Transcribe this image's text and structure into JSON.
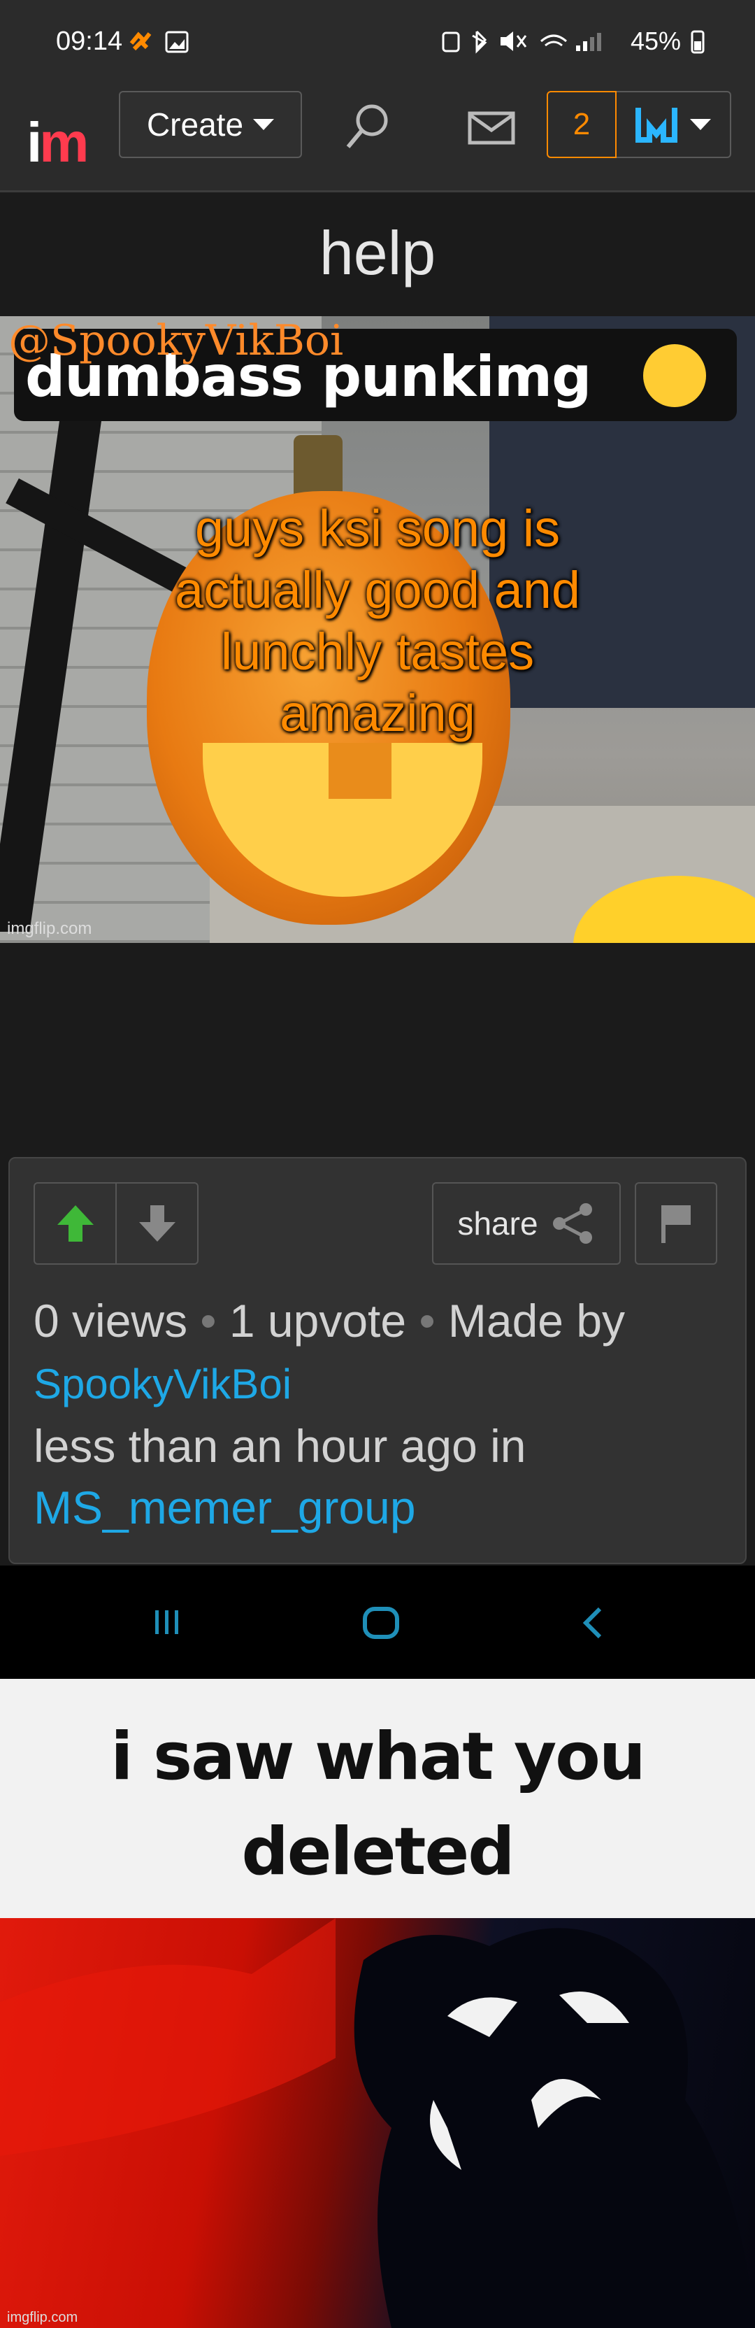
{
  "status_bar": {
    "time": "09:14",
    "battery": "45%"
  },
  "nav": {
    "logo_i": "i",
    "logo_m": "m",
    "create_label": "Create",
    "notification_count": "2"
  },
  "post": {
    "title": "help",
    "image": {
      "watermark_handle": "@SpookyVikBoi",
      "template_caption": "dumbass punkimg",
      "overlay_text": "guys ksi song is actually good and lunchly tastes amazing",
      "site_watermark": "imgflip.com"
    },
    "stats": {
      "views": "0 views",
      "upvotes": "1 upvote",
      "made_by_label": "Made by",
      "author": "SpookyVikBoi",
      "time_text": "less than an hour ago in",
      "stream": "MS_memer_group"
    },
    "share_label": "share"
  },
  "second_meme": {
    "text": "i saw what you deleted",
    "watermark": "imgflip.com"
  },
  "colors": {
    "accent_orange": "#ff8a00",
    "link_blue": "#1ea8e6",
    "logo_red": "#ff3b4e",
    "upvote_green": "#3fb838"
  }
}
